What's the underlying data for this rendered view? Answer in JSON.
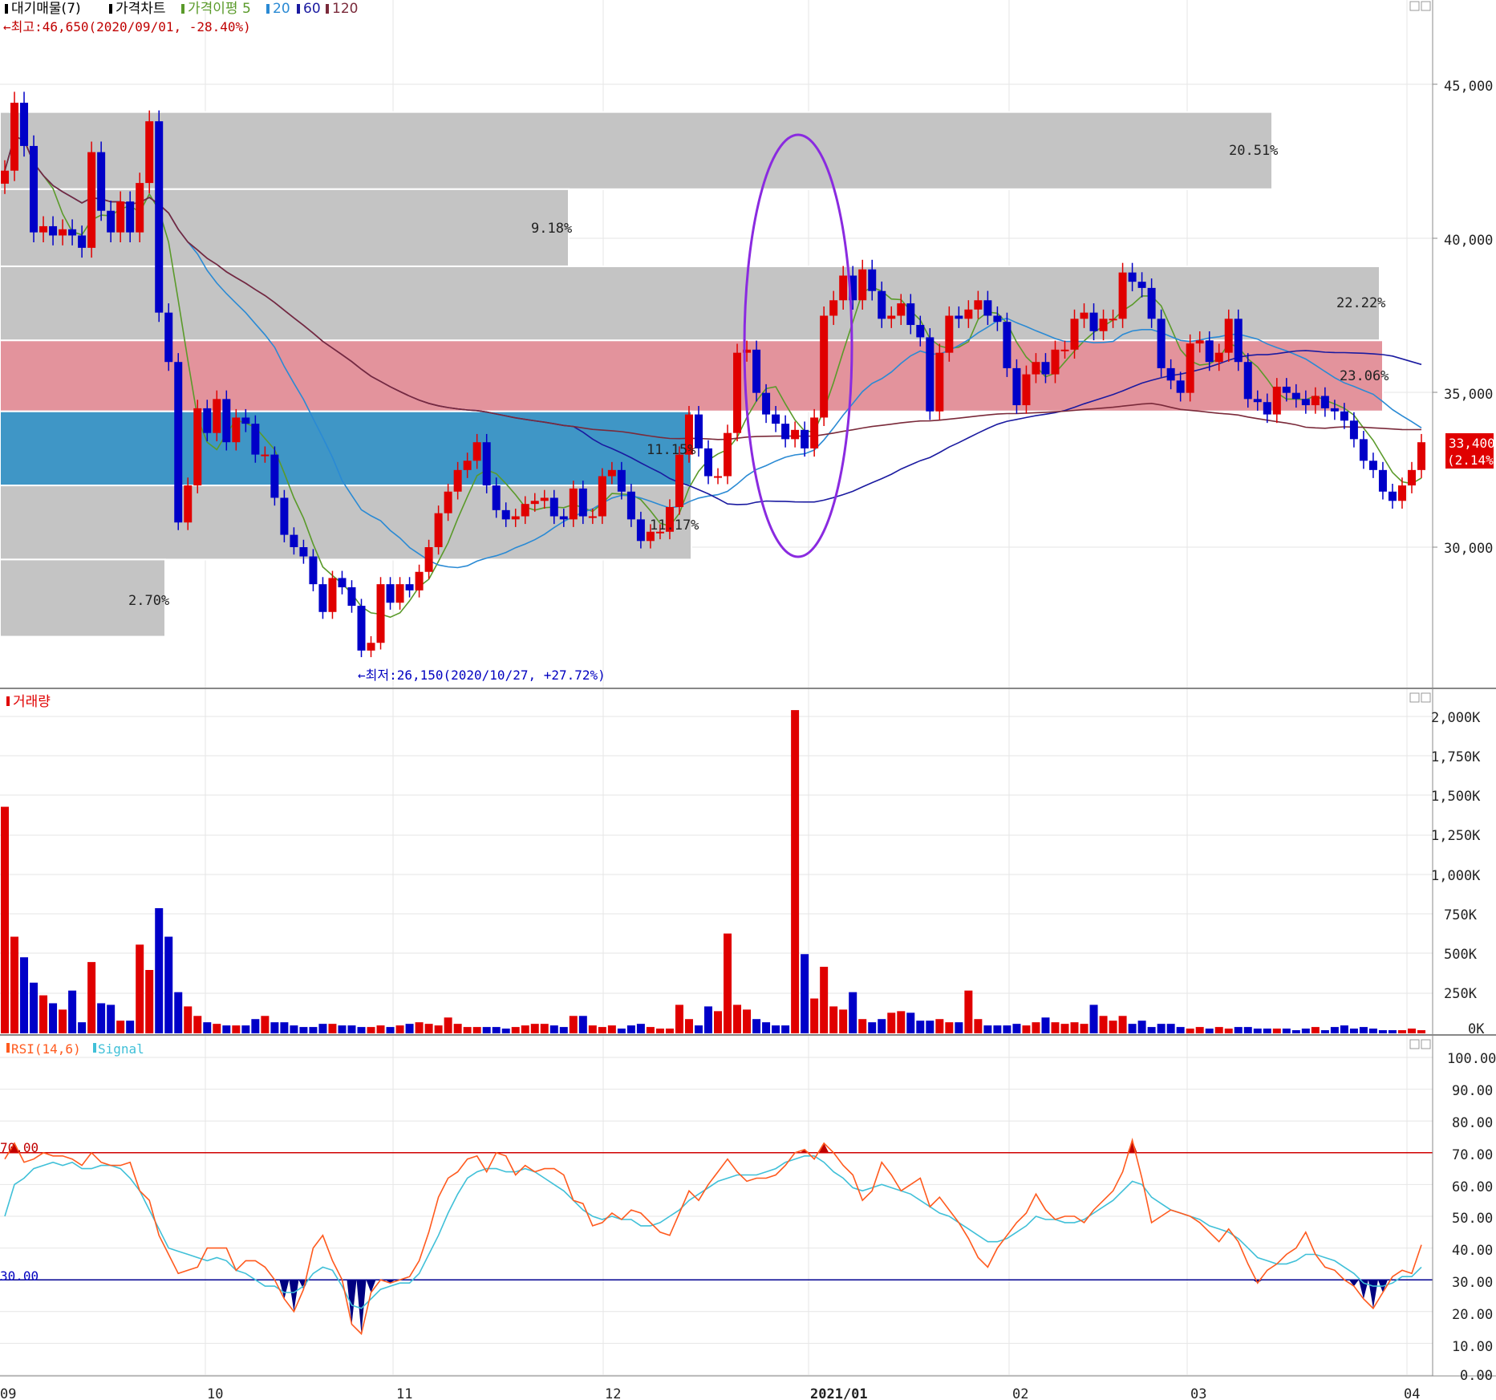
{
  "price_panel": {
    "legend": [
      {
        "text": "대기매물(7)",
        "color": "#000000"
      },
      {
        "text": "가격차트",
        "color": "#000000"
      },
      {
        "text": "가격이평 5",
        "color": "#5a9a2a"
      },
      {
        "text": "20",
        "color": "#2a8ad4"
      },
      {
        "text": "60",
        "color": "#1a1aa0"
      },
      {
        "text": "120",
        "color": "#7a2a3a"
      }
    ],
    "high_note": "←최고:46,650(2020/09/01, -28.40%)",
    "low_note": "←최저:26,150(2020/10/27, +27.72%)",
    "y_ticks": [
      "45,000",
      "40,000",
      "35,000",
      "30,000"
    ],
    "current_price": "33,400",
    "current_change": "(2.14%)",
    "zone_labels": [
      "20.51%",
      "9.18%",
      "22.22%",
      "23.06%",
      "11.15%",
      "11.17%",
      "2.70%"
    ]
  },
  "volume_panel": {
    "legend": "거래량",
    "y_ticks": [
      "2,000K",
      "1,750K",
      "1,500K",
      "1,250K",
      "1,000K",
      "750K",
      "500K",
      "250K",
      "0K"
    ]
  },
  "rsi_panel": {
    "legend_rsi": "RSI(14,6)",
    "legend_signal": "Signal",
    "y_ticks": [
      "100.00",
      "90.00",
      "80.00",
      "70.00",
      "60.00",
      "50.00",
      "40.00",
      "30.00",
      "20.00",
      "10.00",
      "0.00"
    ],
    "overbought_label": "70.00",
    "oversold_label": "30.00"
  },
  "x_labels": [
    "09",
    "10",
    "11",
    "12",
    "2021/01",
    "02",
    "03",
    "04"
  ],
  "colors": {
    "up": "#e00000",
    "down": "#0000c8",
    "ma5": "#5a9a2a",
    "ma20": "#2a8ad4",
    "ma60": "#1a1aa0",
    "ma120": "#7a2a3a",
    "zone_gray": "#c4c4c4",
    "zone_pink": "#e3939c",
    "zone_blue": "#3f96c6",
    "rsi": "#ff5a1e",
    "signal": "#40c0d8",
    "ellipse": "#8a2ae0"
  },
  "chart_data": [
    {
      "type": "candlestick",
      "title": "가격차트",
      "x_range": [
        "2020-09-01",
        "2021-04-02"
      ],
      "y_range": [
        25000,
        47000
      ],
      "high": {
        "value": 46650,
        "date": "2020-09-01"
      },
      "low": {
        "value": 26150,
        "date": "2020-10-27"
      },
      "last": {
        "value": 33400,
        "change_pct": 2.14
      },
      "closes": [
        42200,
        44400,
        43000,
        40200,
        40400,
        40100,
        40300,
        40100,
        39700,
        42800,
        40900,
        40200,
        41200,
        40200,
        41800,
        43800,
        37600,
        36000,
        30800,
        32000,
        34500,
        33700,
        34800,
        33400,
        34200,
        34000,
        33000,
        33000,
        31600,
        30400,
        30000,
        29700,
        28800,
        27900,
        29000,
        28700,
        28100,
        26650,
        26900,
        28800,
        28200,
        28800,
        28600,
        29200,
        30000,
        31100,
        31800,
        32500,
        32800,
        33400,
        32000,
        31200,
        30900,
        31000,
        31400,
        31500,
        31600,
        31000,
        30900,
        31900,
        31000,
        31000,
        32300,
        32500,
        31800,
        30900,
        30200,
        30500,
        30500,
        31300,
        33000,
        34300,
        33200,
        32300,
        32300,
        33700,
        36300,
        36400,
        35000,
        34300,
        34000,
        33500,
        33800,
        33200,
        34200,
        37500,
        38000,
        38800,
        38000,
        39000,
        38300,
        37400,
        37500,
        37900,
        37200,
        36800,
        34400,
        36300,
        37500,
        37400,
        37700,
        38000,
        37500,
        37300,
        35800,
        34600,
        35600,
        36000,
        35600,
        36400,
        36400,
        37400,
        37600,
        37000,
        37400,
        37400,
        38900,
        38600,
        38400,
        37400,
        35800,
        35400,
        35000,
        36600,
        36700,
        36000,
        36300,
        37400,
        36000,
        34800,
        34700,
        34300,
        35200,
        35000,
        34800,
        34600,
        34900,
        34500,
        34400,
        34100,
        33500,
        32800,
        32500,
        31800,
        31500,
        32000,
        32500,
        33400
      ],
      "zones": [
        {
          "low": 41600,
          "high": 44100,
          "pct": 20.51
        },
        {
          "low": 39100,
          "high": 41600,
          "pct": 9.18
        },
        {
          "low": 36700,
          "high": 39100,
          "pct": 22.22
        },
        {
          "low": 34400,
          "high": 36700,
          "pct": 23.06
        },
        {
          "low": 32000,
          "high": 34400,
          "pct": 11.15
        },
        {
          "low": 29600,
          "high": 32000,
          "pct": 11.17
        },
        {
          "low": 27100,
          "high": 29600,
          "pct": 2.7
        }
      ]
    },
    {
      "type": "bar",
      "title": "거래량",
      "unit": "K",
      "y_range": [
        0,
        2000
      ],
      "values": [
        1430,
        610,
        480,
        320,
        240,
        190,
        150,
        270,
        70,
        450,
        190,
        180,
        80,
        80,
        560,
        400,
        790,
        610,
        260,
        170,
        110,
        70,
        60,
        50,
        50,
        50,
        90,
        110,
        70,
        70,
        50,
        40,
        40,
        60,
        60,
        50,
        50,
        40,
        40,
        50,
        40,
        50,
        60,
        70,
        60,
        50,
        100,
        60,
        40,
        40,
        40,
        40,
        30,
        40,
        50,
        60,
        60,
        50,
        40,
        110,
        110,
        50,
        40,
        50,
        30,
        50,
        60,
        40,
        30,
        30,
        180,
        90,
        50,
        170,
        140,
        630,
        180,
        150,
        90,
        70,
        50,
        50,
        2040,
        500,
        220,
        420,
        170,
        150,
        260,
        90,
        70,
        90,
        130,
        140,
        130,
        80,
        80,
        90,
        70,
        70,
        270,
        90,
        50,
        50,
        50,
        60,
        50,
        70,
        100,
        70,
        60,
        70,
        60,
        180,
        110,
        80,
        110,
        60,
        80,
        40,
        60,
        60,
        40,
        30,
        40,
        30,
        40,
        30,
        40,
        40,
        30,
        30,
        30,
        30,
        20,
        30,
        40,
        20,
        40,
        50,
        30,
        40,
        30,
        20,
        20,
        20,
        30,
        20
      ]
    },
    {
      "type": "line",
      "title": "RSI(14,6)",
      "y_range": [
        0,
        100
      ],
      "reference_lines": [
        70,
        30
      ],
      "series": [
        {
          "name": "RSI(14,6)",
          "values": [
            68,
            73,
            67,
            68,
            70,
            69,
            69,
            68,
            66,
            70,
            67,
            66,
            66,
            67,
            58,
            55,
            44,
            38,
            32,
            33,
            34,
            40,
            40,
            40,
            33,
            36,
            36,
            34,
            30,
            24,
            20,
            27,
            40,
            44,
            36,
            30,
            16,
            13,
            26,
            30,
            29,
            30,
            31,
            36,
            45,
            56,
            62,
            64,
            68,
            69,
            64,
            70,
            69,
            63,
            66,
            64,
            65,
            65,
            63,
            55,
            54,
            47,
            48,
            51,
            49,
            52,
            51,
            48,
            45,
            44,
            51,
            58,
            55,
            60,
            64,
            68,
            64,
            61,
            62,
            62,
            63,
            66,
            70,
            71,
            68,
            73,
            70,
            66,
            63,
            55,
            58,
            67,
            63,
            58,
            60,
            62,
            53,
            56,
            52,
            48,
            43,
            37,
            34,
            40,
            44,
            48,
            51,
            57,
            52,
            49,
            50,
            50,
            48,
            52,
            55,
            58,
            64,
            74,
            62,
            48,
            50,
            52,
            51,
            50,
            48,
            45,
            42,
            46,
            42,
            35,
            29,
            33,
            35,
            38,
            40,
            45,
            38,
            34,
            33,
            30,
            28,
            24,
            21,
            26,
            31,
            33,
            32,
            41
          ]
        },
        {
          "name": "Signal",
          "values": [
            50,
            60,
            62,
            65,
            66,
            67,
            66,
            67,
            65,
            65,
            66,
            66,
            65,
            62,
            58,
            52,
            46,
            40,
            39,
            38,
            37,
            36,
            37,
            36,
            33,
            32,
            30,
            28,
            28,
            26,
            26,
            28,
            32,
            34,
            33,
            28,
            22,
            21,
            24,
            27,
            28,
            29,
            29,
            32,
            38,
            44,
            51,
            57,
            62,
            64,
            65,
            65,
            64,
            64,
            65,
            64,
            62,
            60,
            58,
            55,
            52,
            50,
            49,
            50,
            49,
            49,
            47,
            47,
            48,
            50,
            52,
            55,
            57,
            59,
            61,
            62,
            63,
            63,
            63,
            64,
            65,
            67,
            68,
            69,
            69,
            67,
            64,
            62,
            59,
            58,
            59,
            60,
            59,
            58,
            57,
            55,
            53,
            51,
            50,
            48,
            46,
            44,
            42,
            42,
            43,
            45,
            47,
            50,
            49,
            49,
            48,
            48,
            49,
            51,
            53,
            55,
            58,
            61,
            60,
            56,
            54,
            52,
            51,
            50,
            49,
            47,
            46,
            45,
            43,
            40,
            37,
            36,
            35,
            35,
            36,
            38,
            38,
            37,
            36,
            34,
            32,
            29,
            28,
            28,
            29,
            31,
            31,
            34
          ]
        }
      ]
    }
  ]
}
